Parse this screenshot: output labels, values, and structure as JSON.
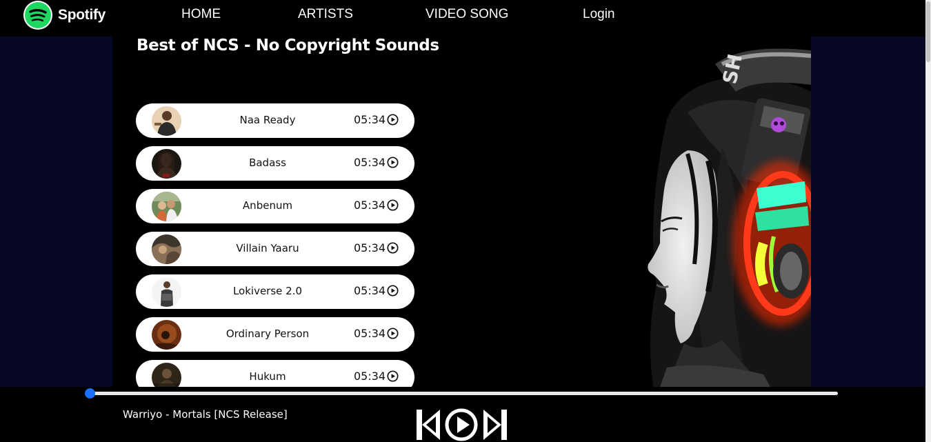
{
  "brand": {
    "name": "Spotify",
    "logo_color": "#1ED760"
  },
  "nav": {
    "home": "HOME",
    "artists": "ARTISTS",
    "video_song": "VIDEO SONG",
    "login": "Login"
  },
  "playlist": {
    "title": "Best of NCS - No Copyright Sounds",
    "songs": [
      {
        "name": "Naa Ready",
        "duration": "05:34"
      },
      {
        "name": "Badass",
        "duration": "05:34"
      },
      {
        "name": "Anbenum",
        "duration": "05:34"
      },
      {
        "name": "Villain Yaaru",
        "duration": "05:34"
      },
      {
        "name": "Lokiverse 2.0",
        "duration": "05:34"
      },
      {
        "name": "Ordinary Person",
        "duration": "05:34"
      },
      {
        "name": "Hukum",
        "duration": "05:34"
      }
    ]
  },
  "player": {
    "now_playing": "Warriyo - Mortals [NCS Release]",
    "progress": 0,
    "accent_color": "#1A6FFF"
  },
  "colors": {
    "page_bg": "#070726",
    "panel_bg": "#000000",
    "song_item_bg": "#FFFFFF"
  }
}
